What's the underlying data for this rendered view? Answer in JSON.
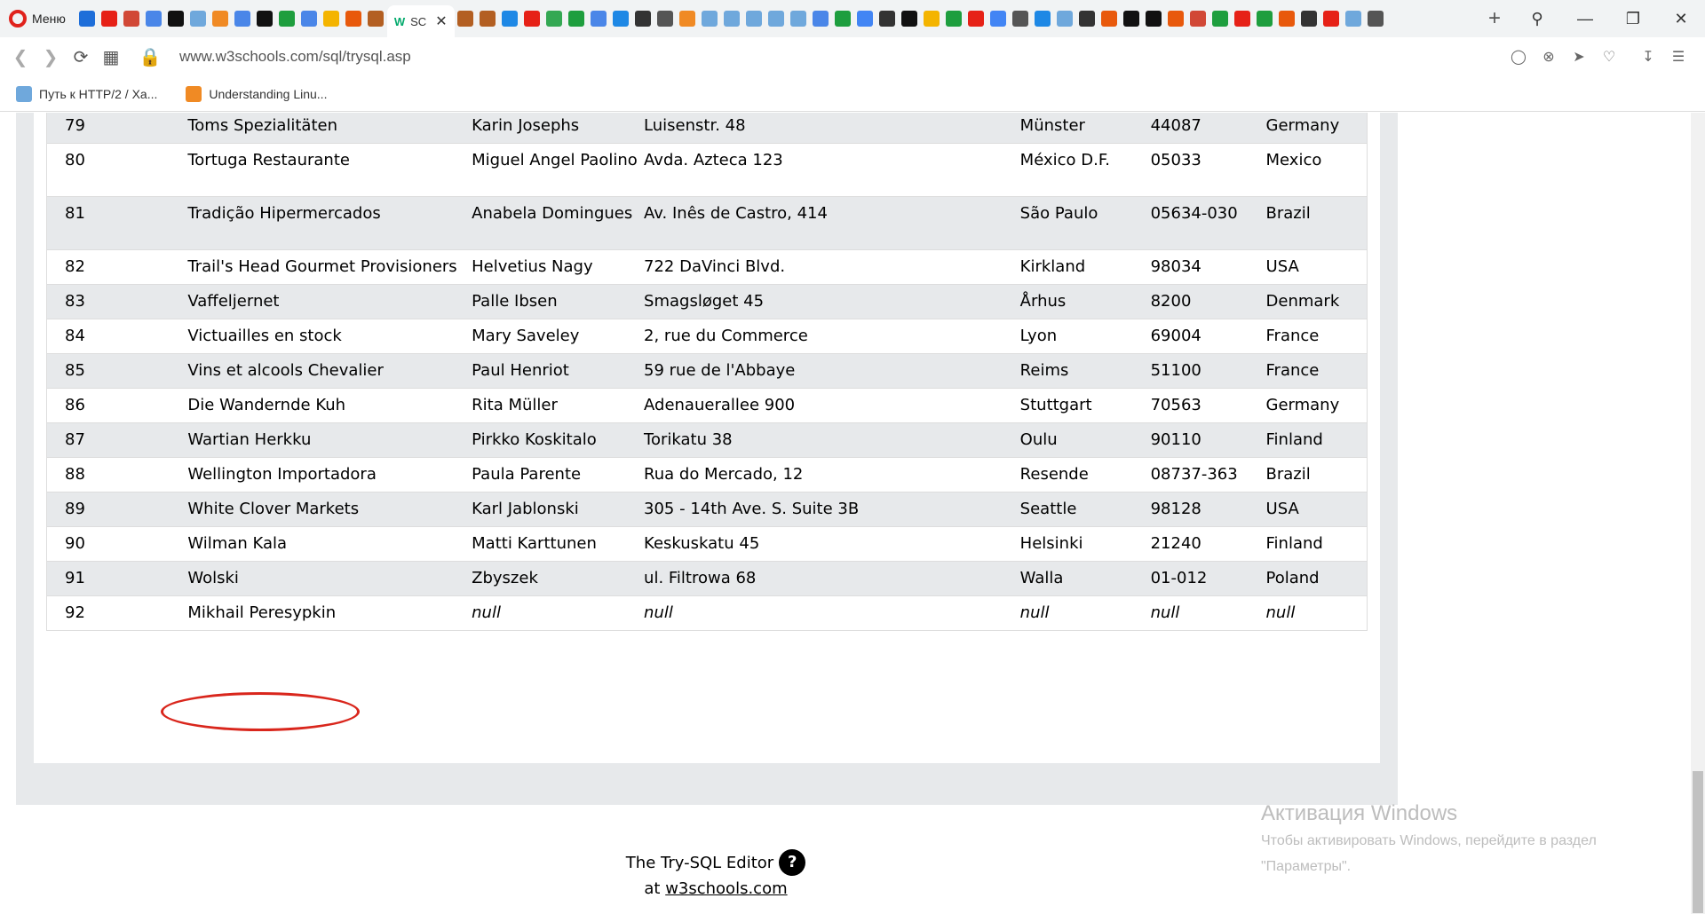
{
  "browser": {
    "menu_label": "Меню",
    "active_tab_favicon": "W",
    "active_tab_title": "SC",
    "url": "www.w3schools.com/sql/trysql.asp",
    "bookmarks": [
      {
        "label": "Путь к HTTP/2 / Ха..."
      },
      {
        "label": "Understanding Linu..."
      }
    ],
    "tab_icon_colors": [
      "#1e6ed9",
      "#e62117",
      "#d14836",
      "#4a86e8",
      "#111111",
      "#6fa8dc",
      "#f08a24",
      "#4a86e8",
      "#111111",
      "#1e9e3e",
      "#4a86e8",
      "#f4b400",
      "#e8590c",
      "#b35f22",
      "#b35f22",
      "#b35f22",
      "#1e88e5",
      "#e62117",
      "#34a853",
      "#1e9e3e",
      "#4a86e8",
      "#1e88e5",
      "#333333",
      "#555555",
      "#f08a24",
      "#6fa8dc",
      "#6fa8dc",
      "#6fa8dc",
      "#6fa8dc",
      "#6fa8dc",
      "#4a86e8",
      "#1e9e3e",
      "#4285f4",
      "#333333",
      "#111111",
      "#f4b400",
      "#1e9e3e",
      "#e62117",
      "#4285f4",
      "#555555",
      "#1e88e5",
      "#6fa8dc",
      "#333333",
      "#e8590c",
      "#111111",
      "#111111",
      "#e8590c",
      "#d14836",
      "#1e9e3e",
      "#e62117",
      "#1e9e3e",
      "#e8590c",
      "#333333",
      "#e62117",
      "#6fa8dc",
      "#555555"
    ]
  },
  "table": {
    "rows": [
      {
        "id": "79",
        "name": "Toms Spezialitäten",
        "contact": "Karin Josephs",
        "address": "Luisenstr. 48",
        "city": "Münster",
        "postal": "44087",
        "country": "Germany"
      },
      {
        "id": "80",
        "name": "Tortuga Restaurante",
        "contact": "Miguel Angel Paolino",
        "address": "Avda. Azteca 123",
        "city": "México D.F.",
        "postal": "05033",
        "country": "Mexico"
      },
      {
        "id": "81",
        "name": "Tradição Hipermercados",
        "contact": "Anabela Domingues",
        "address": "Av. Inês de Castro, 414",
        "city": "São Paulo",
        "postal": "05634-030",
        "country": "Brazil"
      },
      {
        "id": "82",
        "name": "Trail's Head Gourmet Provisioners",
        "contact": "Helvetius Nagy",
        "address": "722 DaVinci Blvd.",
        "city": "Kirkland",
        "postal": "98034",
        "country": "USA"
      },
      {
        "id": "83",
        "name": "Vaffeljernet",
        "contact": "Palle Ibsen",
        "address": "Smagsløget 45",
        "city": "Århus",
        "postal": "8200",
        "country": "Denmark"
      },
      {
        "id": "84",
        "name": "Victuailles en stock",
        "contact": "Mary Saveley",
        "address": "2, rue du Commerce",
        "city": "Lyon",
        "postal": "69004",
        "country": "France"
      },
      {
        "id": "85",
        "name": "Vins et alcools Chevalier",
        "contact": "Paul Henriot",
        "address": "59 rue de l'Abbaye",
        "city": "Reims",
        "postal": "51100",
        "country": "France"
      },
      {
        "id": "86",
        "name": "Die Wandernde Kuh",
        "contact": "Rita Müller",
        "address": "Adenauerallee 900",
        "city": "Stuttgart",
        "postal": "70563",
        "country": "Germany"
      },
      {
        "id": "87",
        "name": "Wartian Herkku",
        "contact": "Pirkko Koskitalo",
        "address": "Torikatu 38",
        "city": "Oulu",
        "postal": "90110",
        "country": "Finland"
      },
      {
        "id": "88",
        "name": "Wellington Importadora",
        "contact": "Paula Parente",
        "address": "Rua do Mercado, 12",
        "city": "Resende",
        "postal": "08737-363",
        "country": "Brazil"
      },
      {
        "id": "89",
        "name": "White Clover Markets",
        "contact": "Karl Jablonski",
        "address": "305 - 14th Ave. S. Suite 3B",
        "city": "Seattle",
        "postal": "98128",
        "country": "USA"
      },
      {
        "id": "90",
        "name": "Wilman Kala",
        "contact": "Matti Karttunen",
        "address": "Keskuskatu 45",
        "city": "Helsinki",
        "postal": "21240",
        "country": "Finland"
      },
      {
        "id": "91",
        "name": "Wolski",
        "contact": "Zbyszek",
        "address": "ul. Filtrowa 68",
        "city": "Walla",
        "postal": "01-012",
        "country": "Poland"
      },
      {
        "id": "92",
        "name": "Mikhail Peresypkin",
        "contact": "null",
        "address": "null",
        "city": "null",
        "postal": "null",
        "country": "null",
        "null_fields": true
      }
    ]
  },
  "footer": {
    "title": "The Try-SQL Editor",
    "help_glyph": "?",
    "at_text": "at",
    "link_text": "w3schools.com"
  },
  "activation": {
    "heading": "Активация Windows",
    "line1": "Чтобы активировать Windows, перейдите в раздел",
    "line2": "\"Параметры\"."
  }
}
